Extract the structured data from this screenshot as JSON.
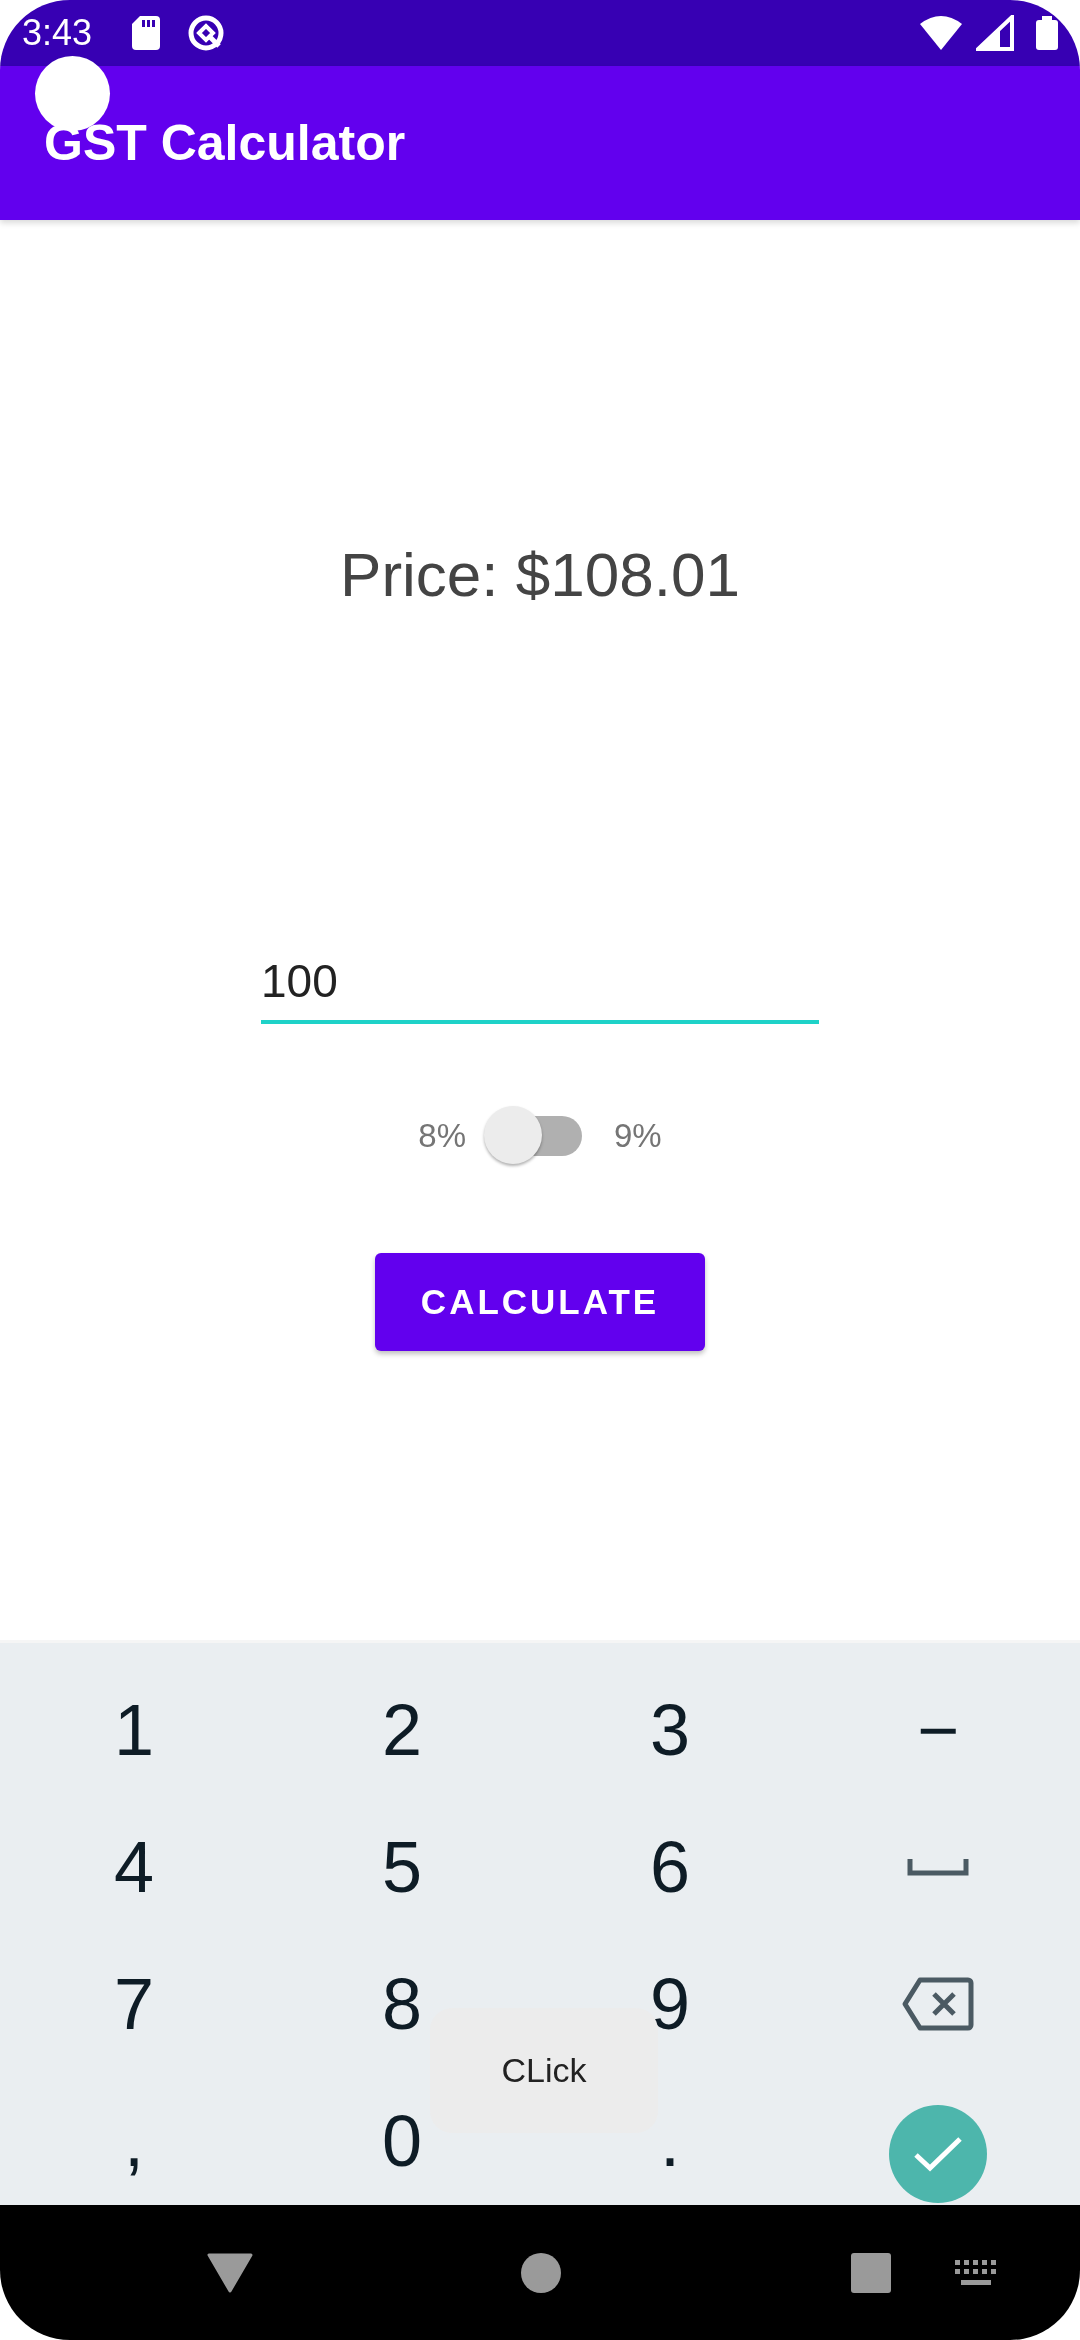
{
  "status_bar": {
    "time": "3:43"
  },
  "app_bar": {
    "title": "GST Calculator"
  },
  "price_label": "Price: $108.01",
  "amount_field": {
    "value": "100"
  },
  "gst_switch": {
    "left_label": "8%",
    "right_label": "9%",
    "on": false
  },
  "calculate_button": "CALCULATE",
  "keyboard": {
    "keys": [
      {
        "kind": "text",
        "label": "1"
      },
      {
        "kind": "text",
        "label": "2"
      },
      {
        "kind": "text",
        "label": "3"
      },
      {
        "kind": "text",
        "label": "−"
      },
      {
        "kind": "text",
        "label": "4"
      },
      {
        "kind": "text",
        "label": "5"
      },
      {
        "kind": "text",
        "label": "6"
      },
      {
        "kind": "space"
      },
      {
        "kind": "text",
        "label": "7"
      },
      {
        "kind": "text",
        "label": "8"
      },
      {
        "kind": "text",
        "label": "9"
      },
      {
        "kind": "backspace"
      },
      {
        "kind": "text",
        "label": ","
      },
      {
        "kind": "text",
        "label": "0"
      },
      {
        "kind": "text",
        "label": "."
      },
      {
        "kind": "done"
      }
    ]
  },
  "toast": {
    "text": "CLick"
  }
}
